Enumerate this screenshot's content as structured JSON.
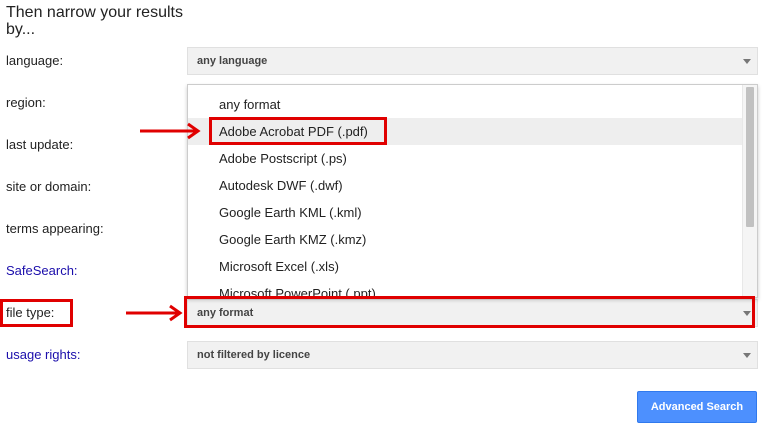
{
  "heading": "Then narrow your results by...",
  "fields": {
    "language": {
      "label": "language:",
      "value": "any language"
    },
    "region": {
      "label": "region:"
    },
    "last_update": {
      "label": "last update:"
    },
    "site_or_domain": {
      "label": "site or domain:"
    },
    "terms_appearing": {
      "label": "terms appearing:"
    },
    "safesearch": {
      "label": "SafeSearch:"
    },
    "file_type": {
      "label": "file type:",
      "value": "any format"
    },
    "usage_rights": {
      "label": "usage rights:",
      "value": "not filtered by licence"
    }
  },
  "dropdown": {
    "options": [
      "any format",
      "Adobe Acrobat PDF (.pdf)",
      "Adobe Postscript (.ps)",
      "Autodesk DWF (.dwf)",
      "Google Earth KML (.kml)",
      "Google Earth KMZ (.kmz)",
      "Microsoft Excel (.xls)",
      "Microsoft PowerPoint (.ppt)"
    ],
    "highlighted_option": "Adobe Acrobat PDF (.pdf)"
  },
  "buttons": {
    "advanced_search": "Advanced Search"
  },
  "colors": {
    "annotation_red": "#e00000",
    "link_blue": "#1a0dab",
    "button_blue": "#4d90fe"
  }
}
